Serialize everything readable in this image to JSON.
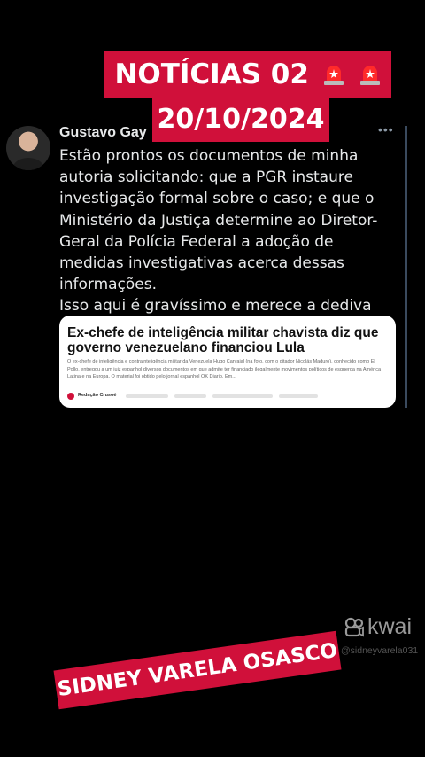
{
  "overlay": {
    "title": "NOTÍCIAS 02",
    "date": "20/10/2024",
    "title_icon": "siren-emoji",
    "footer_text": "SIDNEY VARELA OSASCO"
  },
  "post": {
    "author": "Gustavo Gay",
    "more_label": "•••",
    "body": "Estão prontos os documentos de minha autoria solicitando: que a PGR instaure investigação formal sobre o caso; e que o Ministério da Justiça determine ao Diretor-Geral da Polícia Federal a adoção de medidas investigativas acerca dessas informações.\nIsso aqui é gravíssimo e merece a dediva atenção!",
    "card": {
      "headline": "Ex-chefe de inteligência militar chavista diz que governo venezuelano financiou Lula",
      "excerpt": "O ex-chefe de inteligência e contrainteligência militar da Venezuela Hugo Carvajal (na foto, com o ditador Nicolás Maduro), conhecido como El Pollo, entregou a um juiz espanhol diversos documentos em que admite ter financiado ilegalmente movimentos políticos de esquerda na América Latina e na Europa. O material foi obtido pelo jornal espanhol OK Diario. Em...",
      "source": "Redação Crusoé"
    }
  },
  "watermark": {
    "brand": "kwai",
    "handle": "@sidneyvarela031"
  },
  "colors": {
    "banner_red": "#d0103a",
    "background": "#000000",
    "card_bg": "#ffffff"
  }
}
